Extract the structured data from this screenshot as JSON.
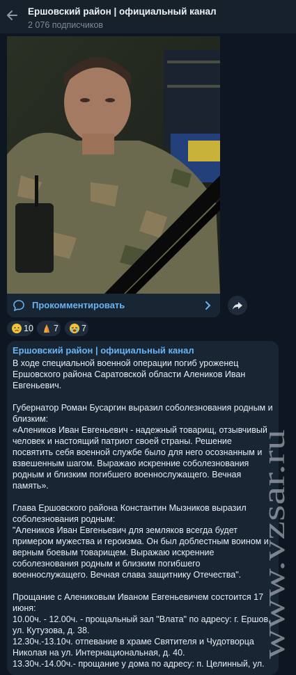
{
  "header": {
    "title": "Ершовский район | официальный канал",
    "subscribers": "2 076 подписчиков"
  },
  "post": {
    "comment_label": "Прокомментировать",
    "reactions": [
      {
        "icon": "crying-face-icon",
        "count": "10"
      },
      {
        "icon": "folded-hands-icon",
        "count": "7"
      },
      {
        "icon": "loudly-crying-face-icon",
        "count": "7"
      }
    ]
  },
  "message": {
    "channel": "Ершовский район | официальный канал",
    "paragraphs": [
      "В ходе специальной военной операции погиб уроженец Ершовского района Саратовской области Алеников Иван Евгеньевич.",
      "Губернатор Роман Бусаргин выразил соболезнования родным и близким:\n«Алеников Иван Евгеньевич - надежный товарищ, отзывчивый человек и настоящий патриот своей страны. Решение посвятить себя военной службе было для него осознанным и взвешенным шагом. Выражаю искренние соболезнования родным и близким погибшего военнослужащего. Вечная память».",
      "Глава Ершовского района Константин Мызников выразил соболезнования родным:\n\"Алеников Иван Евгеньевич для земляков всегда будет примером мужества и героизма. Он был доблестным воином и верным боевым товарищем. Выражаю искренние соболезнования родным и близким погибшего военнослужащего. Вечная слава защитнику Отечества\".",
      "Прощание с Алениковым Иваном Евгеньевичем состоится 17 июня:\n10.00ч. - 12.00ч. - прощальный зал \"Влата\" по адресу: г. Ершов, ул. Кутузова, д. 38.\n12.30ч.-13.10ч. отпевание в храме Святителя и Чудотворца Николая на ул. Интернациональная, д. 40.\n13.30ч.-14.00ч.- прощание у дома по адресу: п. Целинный, ул."
    ]
  },
  "watermark": "www.vzsar.ru",
  "colors": {
    "background": "#0e1621",
    "header": "#17212b",
    "bubble": "#182533",
    "accent": "#6ab3f3",
    "text": "#e9eef4",
    "muted": "#7c8a98"
  }
}
